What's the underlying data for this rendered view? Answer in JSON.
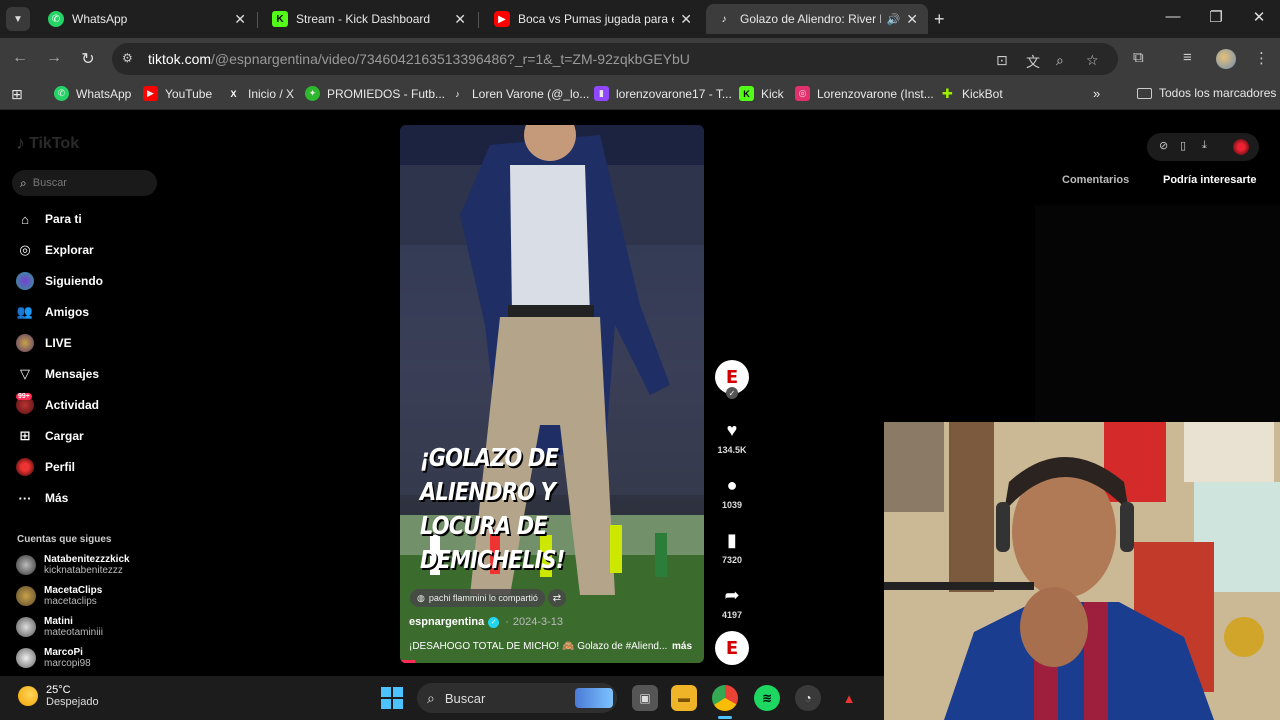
{
  "browser": {
    "tabs": [
      {
        "title": "WhatsApp",
        "icon": "whatsapp-icon",
        "color": "#25d366",
        "active": false
      },
      {
        "title": "Stream - Kick Dashboard",
        "icon": "kick-icon",
        "color": "#53fc18",
        "active": false
      },
      {
        "title": "Boca vs Pumas jugada para exp",
        "icon": "youtube-icon",
        "color": "#ff0000",
        "active": false
      },
      {
        "title": "Golazo de Aliendro: River P",
        "icon": "tiktok-icon",
        "color": "#ffffff",
        "active": true
      }
    ],
    "url": {
      "host": "tiktok.com",
      "path": "/@espnargentina/video/7346042163513396486?_r=1&_t=ZM-92zqkbGEYbU"
    },
    "bookmarks": [
      {
        "label": "WhatsApp",
        "icon": "whatsapp-icon",
        "color": "#25d366"
      },
      {
        "label": "YouTube",
        "icon": "youtube-icon",
        "color": "#ff0000"
      },
      {
        "label": "Inicio / X",
        "icon": "x-icon",
        "color": "#ffffff"
      },
      {
        "label": "PROMIEDOS - Futb...",
        "icon": "promiedos-icon",
        "color": "#2eb82e"
      },
      {
        "label": "Loren Varone (@_lo...",
        "icon": "tiktok-icon",
        "color": "#ffffff"
      },
      {
        "label": "lorenzovarone17 - T...",
        "icon": "twitch-icon",
        "color": "#9146ff"
      },
      {
        "label": "Kick",
        "icon": "kick-icon",
        "color": "#53fc18"
      },
      {
        "label": "Lorenzovarone (Inst...",
        "icon": "instagram-icon",
        "color": "#e1306c"
      },
      {
        "label": "KickBot",
        "icon": "kickbot-icon",
        "color": "#9cf000"
      }
    ],
    "all_bookmarks": "Todos los marcadores"
  },
  "tiktok": {
    "logo": "TikTok",
    "search_placeholder": "Buscar",
    "nav": [
      {
        "label": "Para ti",
        "icon": "home-icon"
      },
      {
        "label": "Explorar",
        "icon": "compass-icon"
      },
      {
        "label": "Siguiendo",
        "icon": "following-icon"
      },
      {
        "label": "Amigos",
        "icon": "friends-icon"
      },
      {
        "label": "LIVE",
        "icon": "live-icon"
      },
      {
        "label": "Mensajes",
        "icon": "messages-icon"
      },
      {
        "label": "Actividad",
        "icon": "activity-icon"
      },
      {
        "label": "Cargar",
        "icon": "upload-icon"
      },
      {
        "label": "Perfil",
        "icon": "profile-icon"
      },
      {
        "label": "Más",
        "icon": "more-icon"
      }
    ],
    "activity_badge": "99+",
    "following_title": "Cuentas que sigues",
    "following": [
      {
        "name": "Natabenitezzzkick",
        "handle": "kicknatabenitezzz"
      },
      {
        "name": "MacetaClips",
        "handle": "macetaclips"
      },
      {
        "name": "Matini",
        "handle": "mateotaminiii"
      },
      {
        "name": "MarcoPi",
        "handle": "marcopi98"
      }
    ],
    "video": {
      "overlay_line1": "¡GOLAZO DE ALIENDRO Y",
      "overlay_line2": "LOCURA DE DEMICHELIS!",
      "shared_by": "pachi flammini lo compartió",
      "author": "espnargentina",
      "date": "2024-3-13",
      "description": "¡DESAHOGO TOTAL DE MICHO! 🙈 Golazo de #Aliend...",
      "more": "más",
      "progress": 0.05
    },
    "actions": {
      "avatar_letter": "E",
      "likes": "134.5K",
      "comments": "1039",
      "saves": "7320",
      "shares": "4197"
    },
    "right_tabs": [
      "Comentarios",
      "Podría interesarte"
    ]
  },
  "taskbar": {
    "temperature": "25°C",
    "condition": "Despejado",
    "search_label": "Buscar"
  }
}
